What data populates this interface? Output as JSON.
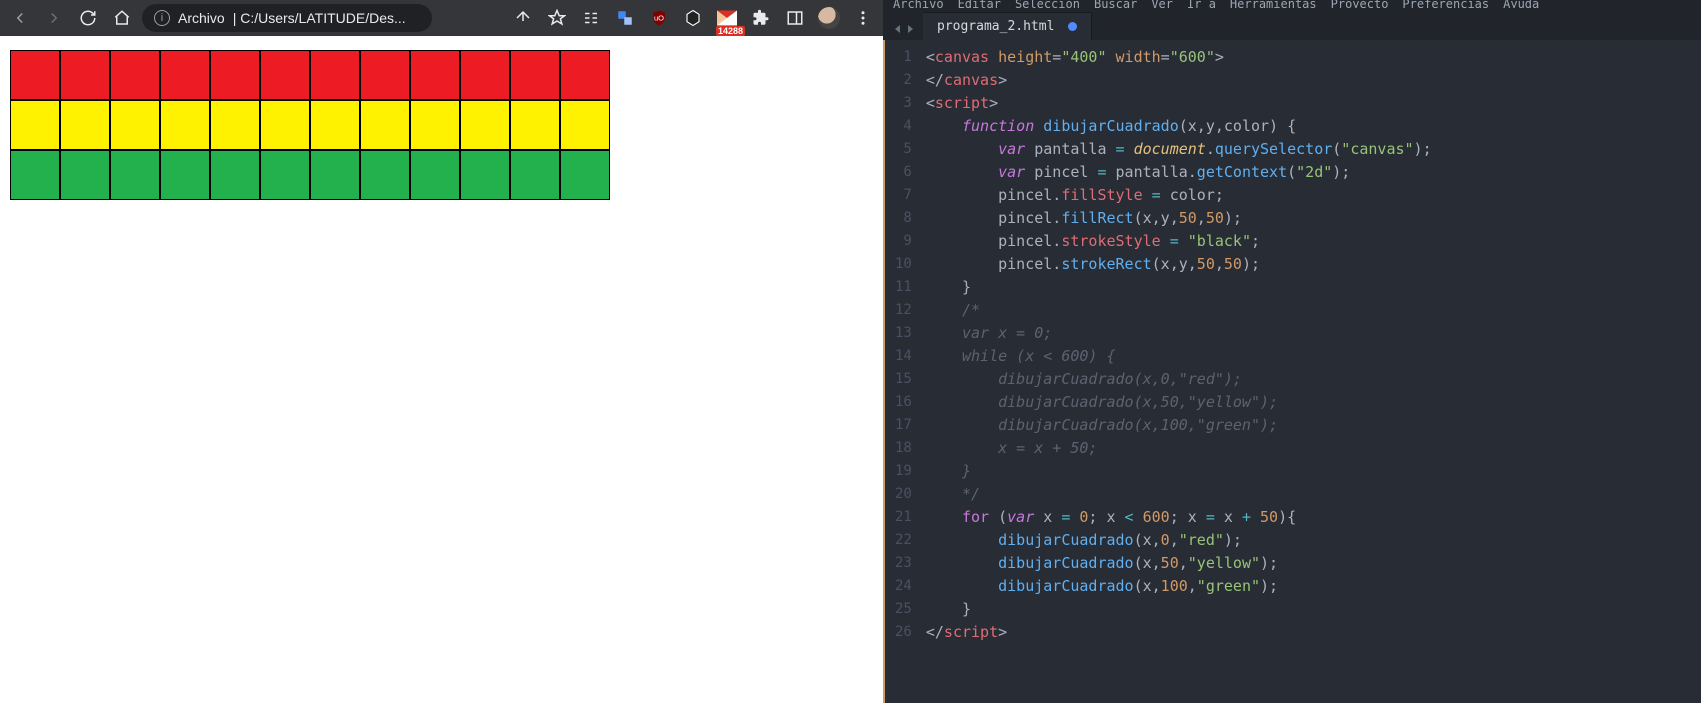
{
  "browser": {
    "url_prefix": "Archivo",
    "url_path": "C:/Users/LATITUDE/Des...",
    "url_combined": " |  C:/Users/LATITUDE/Des...",
    "mail_badge": "14288"
  },
  "canvas": {
    "rows": [
      "red",
      "yellow",
      "green"
    ],
    "cols": 12
  },
  "editor": {
    "menu_items": [
      "Archivo",
      "Editar",
      "Selección",
      "Buscar",
      "Ver",
      "Ir a",
      "Herramientas",
      "Proyecto",
      "Preferencias",
      "Ayuda"
    ],
    "tab_name": "programa_2.html",
    "code_lines": [
      {
        "n": 1,
        "html": "<span class='tok-punct'>&lt;</span><span class='tok-tag'>canvas</span> <span class='tok-attr'>height</span><span class='tok-punct'>=</span><span class='tok-str'>\"400\"</span> <span class='tok-attr'>width</span><span class='tok-punct'>=</span><span class='tok-str'>\"600\"</span><span class='tok-punct'>&gt;</span>"
      },
      {
        "n": 2,
        "html": "<span class='tok-punct'>&lt;/</span><span class='tok-tag'>canvas</span><span class='tok-punct'>&gt;</span>"
      },
      {
        "n": 3,
        "html": "<span class='tok-punct'>&lt;</span><span class='tok-tag'>script</span><span class='tok-punct'>&gt;</span>"
      },
      {
        "n": 4,
        "html": "    <span class='tok-kw'>function</span> <span class='tok-func'>dibujarCuadrado</span><span class='tok-punct'>(</span><span class='tok-plain'>x</span><span class='tok-punct'>,</span><span class='tok-plain'>y</span><span class='tok-punct'>,</span><span class='tok-plain'>color</span><span class='tok-punct'>) {</span>"
      },
      {
        "n": 5,
        "html": "        <span class='tok-kw'>var</span> <span class='tok-plain'>pantalla</span> <span class='tok-op'>=</span> <span class='tok-obj'>document</span><span class='tok-punct'>.</span><span class='tok-func'>querySelector</span><span class='tok-punct'>(</span><span class='tok-str'>\"canvas\"</span><span class='tok-punct'>);</span>"
      },
      {
        "n": 6,
        "html": "        <span class='tok-kw'>var</span> <span class='tok-plain'>pincel</span> <span class='tok-op'>=</span> <span class='tok-plain'>pantalla</span><span class='tok-punct'>.</span><span class='tok-func'>getContext</span><span class='tok-punct'>(</span><span class='tok-str'>\"2d\"</span><span class='tok-punct'>);</span>"
      },
      {
        "n": 7,
        "html": "        <span class='tok-plain'>pincel</span><span class='tok-punct'>.</span><span class='tok-var'>fillStyle</span> <span class='tok-op'>=</span> <span class='tok-plain'>color</span><span class='tok-punct'>;</span>"
      },
      {
        "n": 8,
        "html": "        <span class='tok-plain'>pincel</span><span class='tok-punct'>.</span><span class='tok-func'>fillRect</span><span class='tok-punct'>(</span><span class='tok-plain'>x</span><span class='tok-punct'>,</span><span class='tok-plain'>y</span><span class='tok-punct'>,</span><span class='tok-num'>50</span><span class='tok-punct'>,</span><span class='tok-num'>50</span><span class='tok-punct'>);</span>"
      },
      {
        "n": 9,
        "html": "        <span class='tok-plain'>pincel</span><span class='tok-punct'>.</span><span class='tok-var'>strokeStyle</span> <span class='tok-op'>=</span> <span class='tok-str'>\"black\"</span><span class='tok-punct'>;</span>"
      },
      {
        "n": 10,
        "html": "        <span class='tok-plain'>pincel</span><span class='tok-punct'>.</span><span class='tok-func'>strokeRect</span><span class='tok-punct'>(</span><span class='tok-plain'>x</span><span class='tok-punct'>,</span><span class='tok-plain'>y</span><span class='tok-punct'>,</span><span class='tok-num'>50</span><span class='tok-punct'>,</span><span class='tok-num'>50</span><span class='tok-punct'>);</span>"
      },
      {
        "n": 11,
        "html": "    <span class='tok-punct'>}</span>"
      },
      {
        "n": 12,
        "html": "    <span class='tok-comment'>/*</span>"
      },
      {
        "n": 13,
        "html": "<span class='tok-comment'>    var x = 0;</span>"
      },
      {
        "n": 14,
        "html": "<span class='tok-comment'>    while (x &lt; 600) {</span>"
      },
      {
        "n": 15,
        "html": "<span class='tok-comment'>        dibujarCuadrado(x,0,\"red\");</span>"
      },
      {
        "n": 16,
        "html": "<span class='tok-comment'>        dibujarCuadrado(x,50,\"yellow\");</span>"
      },
      {
        "n": 17,
        "html": "<span class='tok-comment'>        dibujarCuadrado(x,100,\"green\");</span>"
      },
      {
        "n": 18,
        "html": "<span class='tok-comment'>        x = x + 50;</span>"
      },
      {
        "n": 19,
        "html": "<span class='tok-comment'>    }</span>"
      },
      {
        "n": 20,
        "html": "<span class='tok-comment'>    */</span>"
      },
      {
        "n": 21,
        "html": "    <span class='tok-kw2'>for</span> <span class='tok-punct'>(</span><span class='tok-kw'>var</span> <span class='tok-plain'>x</span> <span class='tok-op'>=</span> <span class='tok-num'>0</span><span class='tok-punct'>;</span> <span class='tok-plain'>x</span> <span class='tok-op'>&lt;</span> <span class='tok-num'>600</span><span class='tok-punct'>;</span> <span class='tok-plain'>x</span> <span class='tok-op'>=</span> <span class='tok-plain'>x</span> <span class='tok-op'>+</span> <span class='tok-num'>50</span><span class='tok-punct'>){</span>"
      },
      {
        "n": 22,
        "html": "        <span class='tok-func'>dibujarCuadrado</span><span class='tok-punct'>(</span><span class='tok-plain'>x</span><span class='tok-punct'>,</span><span class='tok-num'>0</span><span class='tok-punct'>,</span><span class='tok-str'>\"red\"</span><span class='tok-punct'>);</span>"
      },
      {
        "n": 23,
        "html": "        <span class='tok-func'>dibujarCuadrado</span><span class='tok-punct'>(</span><span class='tok-plain'>x</span><span class='tok-punct'>,</span><span class='tok-num'>50</span><span class='tok-punct'>,</span><span class='tok-str'>\"yellow\"</span><span class='tok-punct'>);</span>"
      },
      {
        "n": 24,
        "html": "        <span class='tok-func'>dibujarCuadrado</span><span class='tok-punct'>(</span><span class='tok-plain'>x</span><span class='tok-punct'>,</span><span class='tok-num'>100</span><span class='tok-punct'>,</span><span class='tok-str'>\"green\"</span><span class='tok-punct'>);</span>"
      },
      {
        "n": 25,
        "html": "    <span class='tok-punct'>}</span>"
      },
      {
        "n": 26,
        "html": "<span class='tok-punct'>&lt;/</span><span class='tok-tag'>script</span><span class='tok-punct'>&gt;</span>"
      }
    ]
  }
}
